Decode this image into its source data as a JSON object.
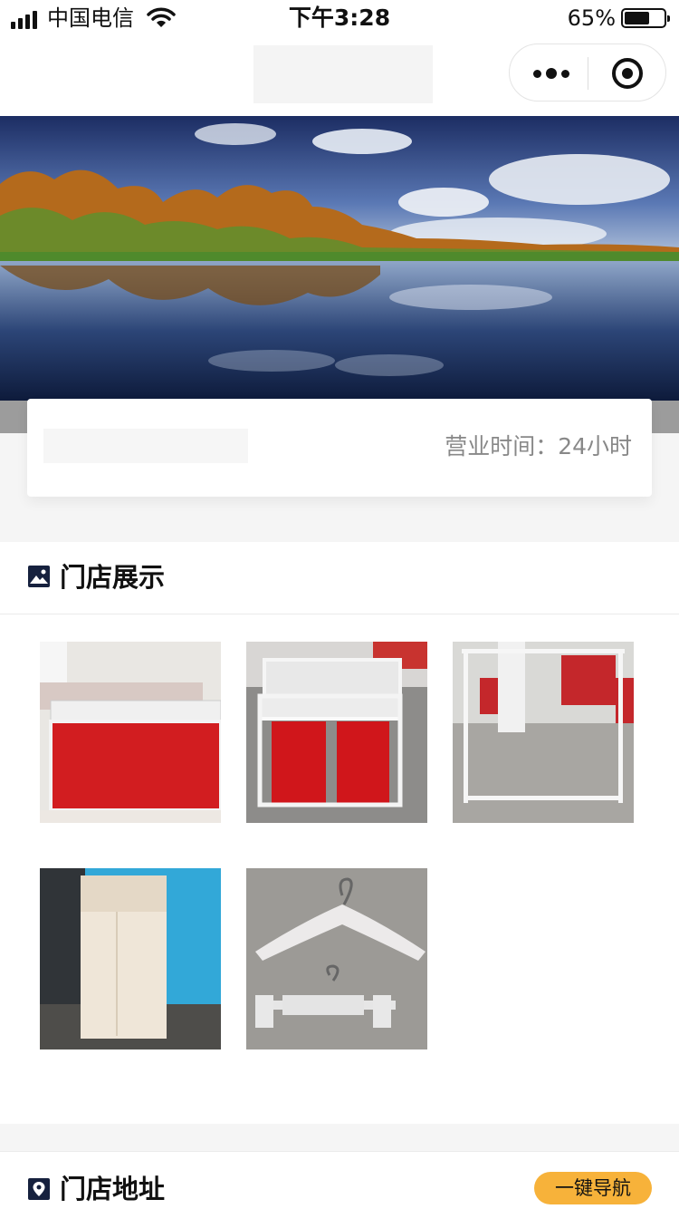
{
  "status_bar": {
    "carrier": "中国电信",
    "time": "下午3:28",
    "battery": "65%",
    "battery_level": 0.65
  },
  "store": {
    "hours": "营业时间：24小时"
  },
  "showcase": {
    "title": "门店展示",
    "icon": "image-icon",
    "photos": [
      {
        "icon": "red-display-counter"
      },
      {
        "icon": "red-cage-cart"
      },
      {
        "icon": "white-clothes-rack"
      },
      {
        "icon": "fitting-room-curtain"
      },
      {
        "icon": "clothes-hanger"
      }
    ]
  },
  "address": {
    "title": "门店地址",
    "icon": "location-pin-icon",
    "navigate_label": "一键导航"
  },
  "colors": {
    "accent": "#f7b23a",
    "background": "#f5f5f5"
  }
}
